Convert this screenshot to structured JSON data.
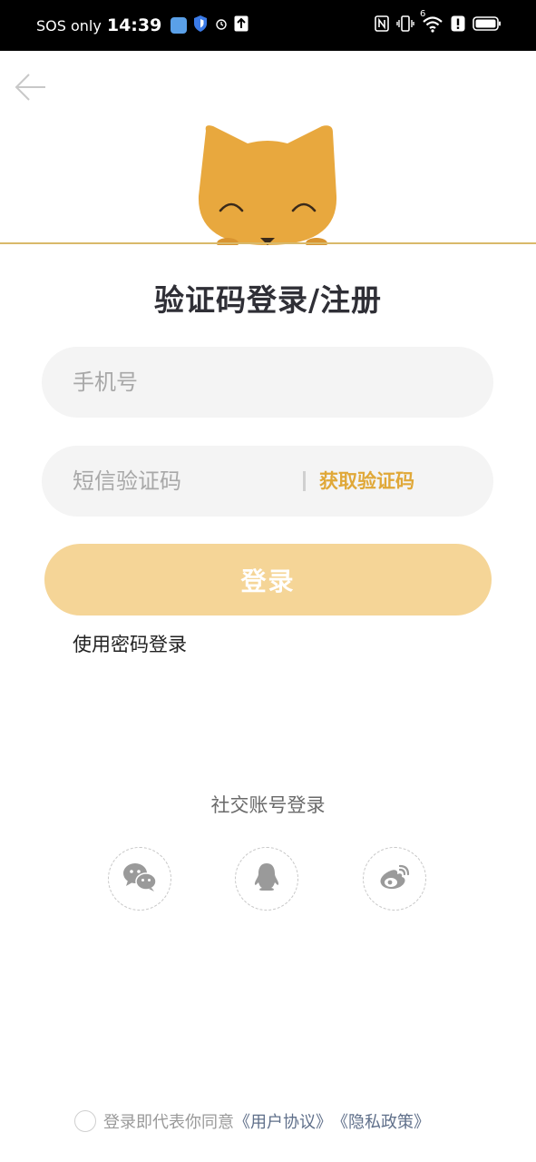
{
  "status_bar": {
    "carrier": "SOS only",
    "time": "14:39",
    "network": "6",
    "icons": [
      "app-icon",
      "shield-icon",
      "alarm-icon",
      "upload-icon",
      "nfc-icon",
      "vibrate-icon",
      "wifi-icon",
      "alert-icon",
      "battery-icon"
    ]
  },
  "nav": {
    "back_icon": "arrow-left-icon"
  },
  "mascot": {
    "name": "fox-mascot",
    "color": "#e8a83e"
  },
  "page": {
    "title": "验证码登录/注册"
  },
  "form": {
    "phone_placeholder": "手机号",
    "code_placeholder": "短信验证码",
    "get_code_label": "获取验证码",
    "login_label": "登录",
    "password_login_label": "使用密码登录"
  },
  "social": {
    "title": "社交账号登录",
    "providers": [
      "wechat-icon",
      "qq-icon",
      "weibo-icon"
    ]
  },
  "agreement": {
    "text": "登录即代表你同意",
    "user_agreement": "《用户协议》",
    "privacy_policy": "《隐私政策》"
  },
  "colors": {
    "accent": "#e0a838",
    "button": "#f5d597",
    "field_bg": "#f4f4f4",
    "line": "#d9b96a"
  }
}
